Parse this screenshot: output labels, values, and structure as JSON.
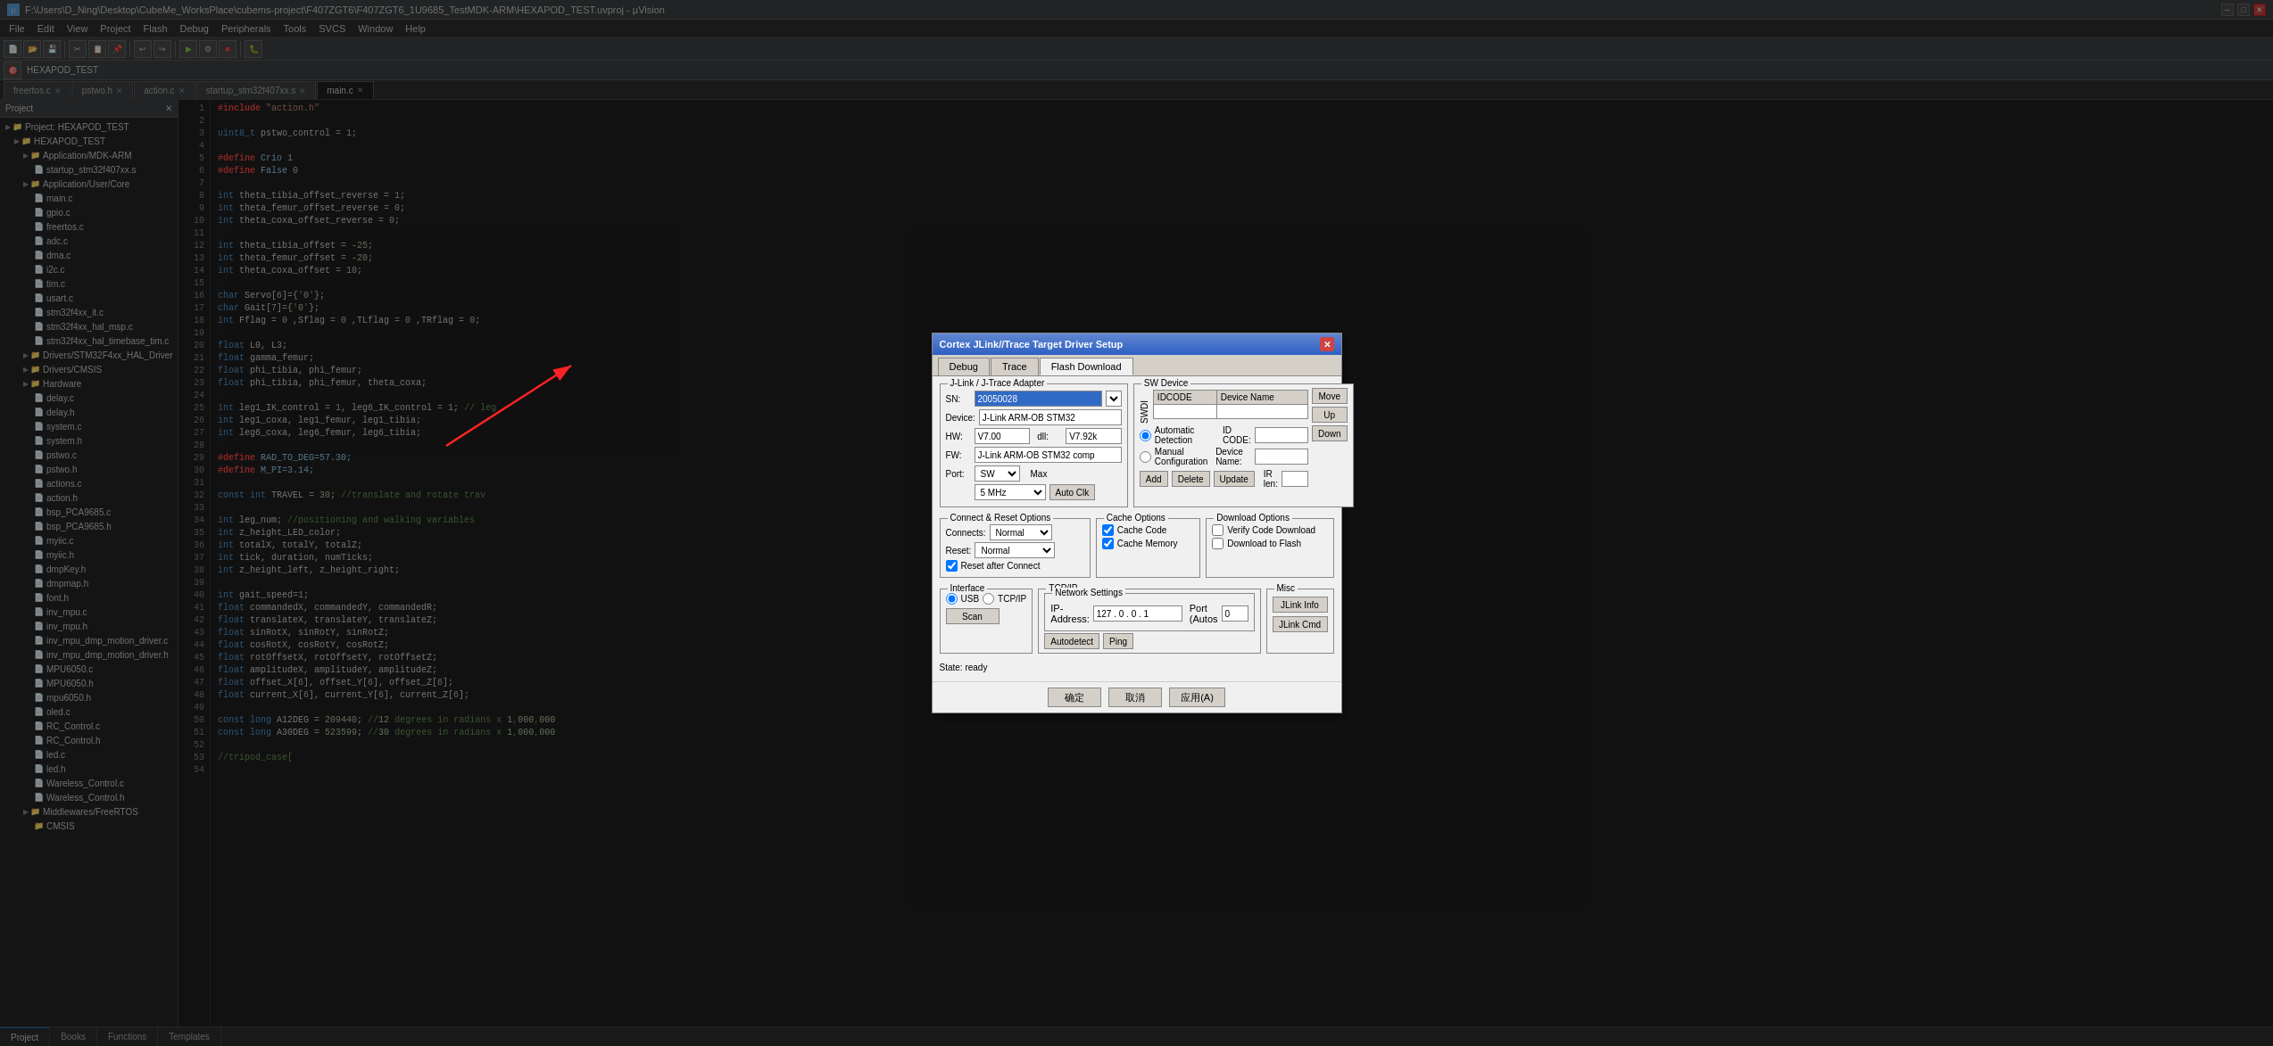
{
  "window": {
    "title": "F:\\Users\\D_Ning\\Desktop\\CubeMe_WorksPlace\\cubems-project\\F407ZGT6\\F407ZGT6_1U9685_TestMDK-ARM\\HEXAPOD_TEST.uvproj - µVision"
  },
  "menu": {
    "items": [
      "File",
      "Edit",
      "View",
      "Project",
      "Flash",
      "Debug",
      "Peripherals",
      "Tools",
      "SVCS",
      "Window",
      "Help"
    ]
  },
  "toolbar2": {
    "path": "HEXAPOD_TEST"
  },
  "project": {
    "title": "Project",
    "tree_items": [
      {
        "label": "Project: HEXAPOD_TEST",
        "indent": 0,
        "icon": "📁"
      },
      {
        "label": "HEXAPOD_TEST",
        "indent": 1,
        "icon": "📁"
      },
      {
        "label": "Application/MDK-ARM",
        "indent": 2,
        "icon": "📁"
      },
      {
        "label": "startup_stm32f407xx.s",
        "indent": 3,
        "icon": "📄"
      },
      {
        "label": "Application/User/Core",
        "indent": 2,
        "icon": "📁"
      },
      {
        "label": "main.c",
        "indent": 3,
        "icon": "📄"
      },
      {
        "label": "gpio.c",
        "indent": 3,
        "icon": "📄"
      },
      {
        "label": "freertos.c",
        "indent": 3,
        "icon": "📄"
      },
      {
        "label": "adc.c",
        "indent": 3,
        "icon": "📄"
      },
      {
        "label": "dma.c",
        "indent": 3,
        "icon": "📄"
      },
      {
        "label": "i2c.c",
        "indent": 3,
        "icon": "📄"
      },
      {
        "label": "tim.c",
        "indent": 3,
        "icon": "📄"
      },
      {
        "label": "usart.c",
        "indent": 3,
        "icon": "📄"
      },
      {
        "label": "stm32f4xx_it.c",
        "indent": 3,
        "icon": "📄"
      },
      {
        "label": "stm32f4xx_hal_msp.c",
        "indent": 3,
        "icon": "📄"
      },
      {
        "label": "stm32f4xx_hal_timebase_tim.c",
        "indent": 3,
        "icon": "📄"
      },
      {
        "label": "Drivers/STM32F4xx_HAL_Driver",
        "indent": 2,
        "icon": "📁"
      },
      {
        "label": "Drivers/CMSIS",
        "indent": 2,
        "icon": "📁"
      },
      {
        "label": "Hardware",
        "indent": 2,
        "icon": "📁"
      },
      {
        "label": "delay.c",
        "indent": 3,
        "icon": "📄"
      },
      {
        "label": "delay.h",
        "indent": 3,
        "icon": "📄"
      },
      {
        "label": "system.c",
        "indent": 3,
        "icon": "📄"
      },
      {
        "label": "system.h",
        "indent": 3,
        "icon": "📄"
      },
      {
        "label": "pstwo.c",
        "indent": 3,
        "icon": "📄"
      },
      {
        "label": "pstwo.h",
        "indent": 3,
        "icon": "📄"
      },
      {
        "label": "actions.c",
        "indent": 3,
        "icon": "📄"
      },
      {
        "label": "action.h",
        "indent": 3,
        "icon": "📄"
      },
      {
        "label": "bsp_PCA9685.c",
        "indent": 3,
        "icon": "📄"
      },
      {
        "label": "bsp_PCA9685.h",
        "indent": 3,
        "icon": "📄"
      },
      {
        "label": "myiic.c",
        "indent": 3,
        "icon": "📄"
      },
      {
        "label": "myiic.h",
        "indent": 3,
        "icon": "📄"
      },
      {
        "label": "dmpKey.h",
        "indent": 3,
        "icon": "📄"
      },
      {
        "label": "dmpmap.h",
        "indent": 3,
        "icon": "📄"
      },
      {
        "label": "font.h",
        "indent": 3,
        "icon": "📄"
      },
      {
        "label": "inv_mpu.c",
        "indent": 3,
        "icon": "📄"
      },
      {
        "label": "inv_mpu.h",
        "indent": 3,
        "icon": "📄"
      },
      {
        "label": "inv_mpu_dmp_motion_driver.c",
        "indent": 3,
        "icon": "📄"
      },
      {
        "label": "inv_mpu_dmp_motion_driver.h",
        "indent": 3,
        "icon": "📄"
      },
      {
        "label": "MPU6050.c",
        "indent": 3,
        "icon": "📄"
      },
      {
        "label": "MPU6050.h",
        "indent": 3,
        "icon": "📄"
      },
      {
        "label": "mpu6050.h",
        "indent": 3,
        "icon": "📄"
      },
      {
        "label": "oled.c",
        "indent": 3,
        "icon": "📄"
      },
      {
        "label": "RC_Control.c",
        "indent": 3,
        "icon": "📄"
      },
      {
        "label": "RC_Control.h",
        "indent": 3,
        "icon": "📄"
      },
      {
        "label": "led.c",
        "indent": 3,
        "icon": "📄"
      },
      {
        "label": "led.h",
        "indent": 3,
        "icon": "📄"
      },
      {
        "label": "Wareless_Control.c",
        "indent": 3,
        "icon": "📄"
      },
      {
        "label": "Wareless_Control.h",
        "indent": 3,
        "icon": "📄"
      },
      {
        "label": "Middlewares/FreeRTOS",
        "indent": 2,
        "icon": "📁"
      },
      {
        "label": "CMSIS",
        "indent": 3,
        "icon": "📁"
      }
    ]
  },
  "tabs": [
    {
      "label": "freertos.c",
      "active": false
    },
    {
      "label": "pstwo.h",
      "active": false
    },
    {
      "label": "action.c",
      "active": false
    },
    {
      "label": "startup_stm32f407xx.s",
      "active": false
    },
    {
      "label": "main.c",
      "active": true
    }
  ],
  "code": {
    "lines": [
      {
        "num": 1,
        "content": "#include \"action.h\""
      },
      {
        "num": 2,
        "content": ""
      },
      {
        "num": 3,
        "content": "uint8_t pstwo_control = 1;"
      },
      {
        "num": 4,
        "content": ""
      },
      {
        "num": 5,
        "content": "#define Crio 1"
      },
      {
        "num": 6,
        "content": "#define False 0"
      },
      {
        "num": 7,
        "content": ""
      },
      {
        "num": 8,
        "content": "int theta_tibia_offset_reverse = 1;"
      },
      {
        "num": 9,
        "content": "int theta_femur_offset_reverse = 0;"
      },
      {
        "num": 10,
        "content": "int theta_coxa_offset_reverse = 0;"
      },
      {
        "num": 11,
        "content": ""
      },
      {
        "num": 12,
        "content": "int theta_tibia_offset = -25;"
      },
      {
        "num": 13,
        "content": "int theta_femur_offset = -20;"
      },
      {
        "num": 14,
        "content": "int theta_coxa_offset = 10;"
      },
      {
        "num": 15,
        "content": ""
      },
      {
        "num": 16,
        "content": "char Servo[6]={'0'};"
      },
      {
        "num": 17,
        "content": "char Gait[7]={'0'};"
      },
      {
        "num": 18,
        "content": "int Fflag = 0 ,Sflag = 0 ,TLflag = 0 ,TRflag = 0;"
      },
      {
        "num": 19,
        "content": ""
      },
      {
        "num": 20,
        "content": "float L0, L3;"
      },
      {
        "num": 21,
        "content": "float gamma_femur;"
      },
      {
        "num": 22,
        "content": "float phi_tibia, phi_femur;"
      },
      {
        "num": 23,
        "content": "float phi_tibia, phi_femur, theta_coxa;"
      },
      {
        "num": 24,
        "content": ""
      },
      {
        "num": 25,
        "content": "int leg1_IK_control = 1, leg6_IK_control = 1; // leg"
      },
      {
        "num": 26,
        "content": "int leg1_coxa, leg1_femur, leg1_tibia;"
      },
      {
        "num": 27,
        "content": "int leg6_coxa, leg6_femur, leg6_tibia;"
      },
      {
        "num": 28,
        "content": ""
      },
      {
        "num": 29,
        "content": "#define RAD_TO_DEG=57.30;"
      },
      {
        "num": 30,
        "content": "#define M_PI=3.14;"
      },
      {
        "num": 31,
        "content": ""
      },
      {
        "num": 32,
        "content": "const int TRAVEL = 30; //translate and rotate trav"
      },
      {
        "num": 33,
        "content": ""
      },
      {
        "num": 34,
        "content": "int leg_num; //positioning and walking variables"
      },
      {
        "num": 35,
        "content": "int z_height_LED_color;"
      },
      {
        "num": 36,
        "content": "int totalX, totalY, totalZ;"
      },
      {
        "num": 37,
        "content": "int tick, duration, numTicks;"
      },
      {
        "num": 38,
        "content": "int z_height_left, z_height_right;"
      },
      {
        "num": 39,
        "content": ""
      },
      {
        "num": 40,
        "content": "int gait_speed=1;"
      },
      {
        "num": 41,
        "content": "float commandedX, commandedY, commandedR;"
      },
      {
        "num": 42,
        "content": "float translateX, translateY, translateZ;"
      },
      {
        "num": 43,
        "content": "float sinRotX, sinRotY, sinRotZ;"
      },
      {
        "num": 44,
        "content": "float cosRotX, cosRotY, cosRotZ;"
      },
      {
        "num": 45,
        "content": "float rotOffsetX, rotOffsetY, rotOffsetZ;"
      },
      {
        "num": 46,
        "content": "float amplitudeX, amplitudeY, amplitudeZ;"
      },
      {
        "num": 47,
        "content": "float offset_X[6], offset_Y[6], offset_Z[6];"
      },
      {
        "num": 48,
        "content": "float current_X[6], current_Y[6], current_Z[6];"
      },
      {
        "num": 49,
        "content": ""
      },
      {
        "num": 50,
        "content": "const long A12DEG = 209440; //12 degrees in radians x 1,000,000"
      },
      {
        "num": 51,
        "content": "const long A30DEG = 523599; //30 degrees in radians x 1,000,000"
      },
      {
        "num": 52,
        "content": ""
      },
      {
        "num": 53,
        "content": "//tripod_case["
      },
      {
        "num": 54,
        "content": ""
      }
    ]
  },
  "dialog": {
    "title": "Cortex JLink//Trace Target Driver Setup",
    "tabs": [
      "Debug",
      "Trace",
      "Flash Download"
    ],
    "active_tab": "Debug",
    "jlink_section": {
      "title": "J-Link / J-Trace Adapter",
      "sn_label": "SN:",
      "sn_value": "20050028",
      "device_label": "Device:",
      "device_value": "J-Link ARM-OB STM32",
      "hw_label": "HW:",
      "hw_value": "V7.00",
      "dll_label": "dll:",
      "dll_value": "V7.92k",
      "fw_label": "FW:",
      "fw_value": "J-Link ARM-OB STM32 comp",
      "port_label": "Port:",
      "port_value": "SW",
      "max_label": "Max",
      "max_value": "5 MHz",
      "auto_clk_btn": "Auto Clk"
    },
    "sw_device_section": {
      "title": "SW Device",
      "swdio_label": "SWDI",
      "columns": [
        "IDCODE",
        "Device Name"
      ],
      "rows": [],
      "move_btn": "Move",
      "up_btn": "Up",
      "down_btn": "Down",
      "auto_detect_label": "Automatic Detection",
      "manual_config_label": "Manual Configuration",
      "id_code_label": "ID CODE:",
      "device_name_label": "Device Name:",
      "add_btn": "Add",
      "delete_btn": "Delete",
      "update_btn": "Update",
      "ir_len_label": "IR len:"
    },
    "connect_reset_section": {
      "title": "Connect & Reset Options",
      "connects_label": "Connects:",
      "connects_value": "Normal",
      "reset_label": "Reset:",
      "reset_value": "Normal",
      "reset_after_connect": "Reset after Connect"
    },
    "cache_options_section": {
      "title": "Cache Options",
      "cache_code": "Cache Code",
      "cache_memory": "Cache Memory"
    },
    "download_options_section": {
      "title": "Download Options",
      "verify_code": "Verify Code Download",
      "download_to_flash": "Download to Flash"
    },
    "interface_section": {
      "title": "Interface",
      "usb_label": "USB",
      "tcpip_label": "TCP/IP",
      "scan_btn": "Scan"
    },
    "tcpip_section": {
      "title": "TCP/IP",
      "network_settings_title": "Network Settings",
      "ip_address_label": "IP-Address:",
      "ip_value": "127 . 0 . 0 . 1",
      "port_label": "Port (Autos",
      "port_value": "0",
      "autodetect_btn": "Autodetect",
      "ping_btn": "Ping"
    },
    "misc_section": {
      "title": "Misc",
      "jlink_info_btn": "JLink Info",
      "jlink_cmd_btn": "JLink Cmd"
    },
    "state": "State: ready",
    "footer": {
      "ok_btn": "确定",
      "cancel_btn": "取消",
      "apply_btn": "应用(A)"
    }
  },
  "bottom_tabs": [
    "Project",
    "Books",
    "Functions",
    "Templates"
  ],
  "status": "ready"
}
